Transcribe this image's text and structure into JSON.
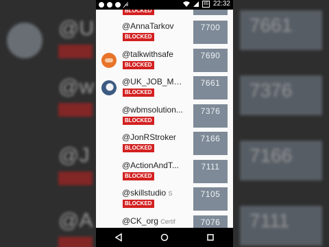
{
  "status_bar": {
    "time": "22:32",
    "battery": "85"
  },
  "rows": [
    {
      "handle": "",
      "tag": "",
      "blocked": "BLOCKED",
      "score": "",
      "avatar": "none"
    },
    {
      "handle": "@AnnaTarkov",
      "tag": "",
      "blocked": "BLOCKED",
      "score": "7700",
      "avatar": "none"
    },
    {
      "handle": "@talkwithsafe",
      "tag": "",
      "blocked": "BLOCKED",
      "score": "7690",
      "avatar": "orange"
    },
    {
      "handle": "@UK_JOB_Ma...",
      "tag": "",
      "blocked": "BLOCKED",
      "score": "7661",
      "avatar": "blue"
    },
    {
      "handle": "@wbmsolution...",
      "tag": "",
      "blocked": "BLOCKED",
      "score": "7376",
      "avatar": "none"
    },
    {
      "handle": "@JonRStroker",
      "tag": "",
      "blocked": "BLOCKED",
      "score": "7166",
      "avatar": "none"
    },
    {
      "handle": "@ActionAndT...",
      "tag": "",
      "blocked": "BLOCKED",
      "score": "7111",
      "avatar": "none"
    },
    {
      "handle": "@skillstudio",
      "tag": "S",
      "blocked": "BLOCKED",
      "score": "7105",
      "avatar": "none"
    },
    {
      "handle": "@CK_org",
      "tag": "Certif",
      "blocked": "",
      "score": "7076",
      "avatar": "none"
    }
  ],
  "background": {
    "left_handles": [
      "@U",
      "@w",
      "@J",
      "@A"
    ],
    "right_scores": [
      "7661",
      "7376",
      "7166",
      "7111"
    ],
    "blocked": "BLOCKED"
  }
}
